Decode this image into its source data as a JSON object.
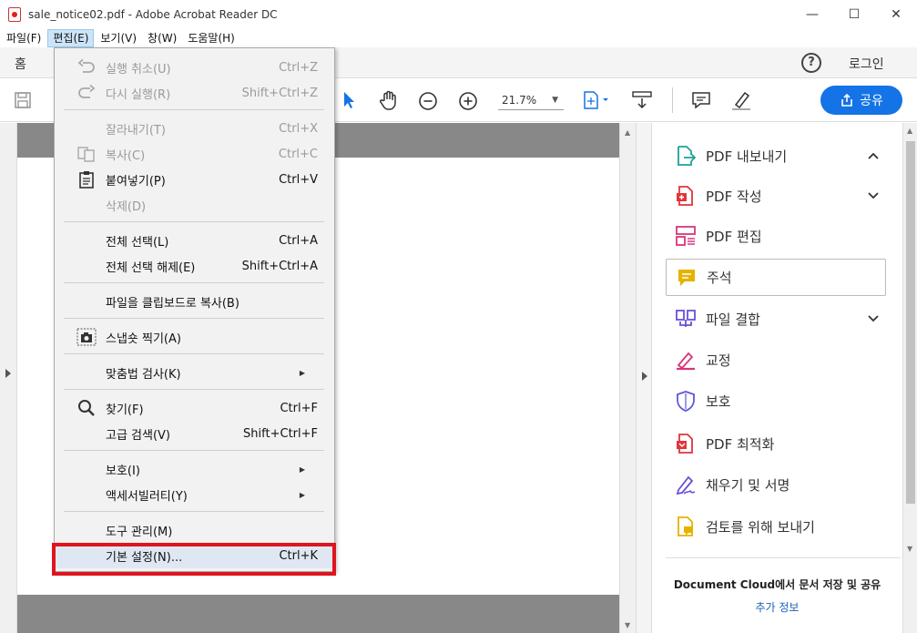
{
  "window": {
    "title": "sale_notice02.pdf - Adobe Acrobat Reader DC",
    "minimize": "—",
    "maximize": "☐",
    "close": "✕"
  },
  "menubar": {
    "items": [
      "파일(F)",
      "편집(E)",
      "보기(V)",
      "창(W)",
      "도움말(H)"
    ],
    "active_index": 1
  },
  "tabbar": {
    "home": "홈",
    "help": "?",
    "login": "로그인"
  },
  "toolbar": {
    "zoom": "21.7%",
    "share": "공유"
  },
  "edit_menu": {
    "items": [
      {
        "label": "실행 취소(U)",
        "shortcut": "Ctrl+Z",
        "disabled": true,
        "icon": "undo-icon"
      },
      {
        "label": "다시 실행(R)",
        "shortcut": "Shift+Ctrl+Z",
        "disabled": true,
        "icon": "redo-icon"
      },
      {
        "label": "잘라내기(T)",
        "shortcut": "Ctrl+X",
        "disabled": true,
        "icon": ""
      },
      {
        "label": "복사(C)",
        "shortcut": "Ctrl+C",
        "disabled": true,
        "icon": "copy-icon"
      },
      {
        "label": "붙여넣기(P)",
        "shortcut": "Ctrl+V",
        "disabled": false,
        "icon": "clipboard-icon"
      },
      {
        "label": "삭제(D)",
        "shortcut": "",
        "disabled": true,
        "icon": ""
      },
      {
        "label": "전체 선택(L)",
        "shortcut": "Ctrl+A",
        "disabled": false,
        "icon": ""
      },
      {
        "label": "전체 선택 해제(E)",
        "shortcut": "Shift+Ctrl+A",
        "disabled": false,
        "icon": ""
      },
      {
        "label": "파일을 클립보드로 복사(B)",
        "shortcut": "",
        "disabled": false,
        "icon": ""
      },
      {
        "label": "스냅숏 찍기(A)",
        "shortcut": "",
        "disabled": false,
        "icon": "camera-icon"
      },
      {
        "label": "맞춤법 검사(K)",
        "shortcut": "",
        "disabled": false,
        "icon": "",
        "submenu": true
      },
      {
        "label": "찾기(F)",
        "shortcut": "Ctrl+F",
        "disabled": false,
        "icon": "search-icon"
      },
      {
        "label": "고급 검색(V)",
        "shortcut": "Shift+Ctrl+F",
        "disabled": false,
        "icon": ""
      },
      {
        "label": "보호(I)",
        "shortcut": "",
        "disabled": false,
        "icon": "",
        "submenu": true
      },
      {
        "label": "액세서빌러티(Y)",
        "shortcut": "",
        "disabled": false,
        "icon": "",
        "submenu": true
      },
      {
        "label": "도구 관리(M)",
        "shortcut": "",
        "disabled": false,
        "icon": ""
      },
      {
        "label": "기본 설정(N)...",
        "shortcut": "Ctrl+K",
        "disabled": false,
        "icon": "",
        "hover": true
      }
    ]
  },
  "tools_panel": {
    "items": [
      {
        "label": "PDF 내보내기",
        "chevron": "up",
        "color": "#1aa39a",
        "icon": "export-pdf-icon"
      },
      {
        "label": "PDF 작성",
        "chevron": "down",
        "color": "#e0353b",
        "icon": "create-pdf-icon"
      },
      {
        "label": "PDF 편집",
        "chevron": "",
        "color": "#d8367b",
        "icon": "edit-pdf-icon"
      },
      {
        "label": "주석",
        "chevron": "",
        "color": "#e6b200",
        "icon": "comment-icon",
        "selected": true
      },
      {
        "label": "파일 결합",
        "chevron": "down",
        "color": "#6b4fd8",
        "icon": "combine-files-icon"
      },
      {
        "label": "교정",
        "chevron": "",
        "color": "#d8367b",
        "icon": "redact-icon"
      },
      {
        "label": "보호",
        "chevron": "",
        "color": "#5b57d9",
        "icon": "protect-icon"
      },
      {
        "label": "PDF 최적화",
        "chevron": "",
        "color": "#e0353b",
        "icon": "optimize-pdf-icon"
      },
      {
        "label": "채우기 및 서명",
        "chevron": "",
        "color": "#6b4fd8",
        "icon": "fill-sign-icon"
      },
      {
        "label": "검토를 위해 보내기",
        "chevron": "",
        "color": "#e6b200",
        "icon": "send-review-icon"
      }
    ],
    "cloud_text": "Document Cloud에서 문서 저장 및 공유",
    "cloud_link": "추가 정보"
  }
}
